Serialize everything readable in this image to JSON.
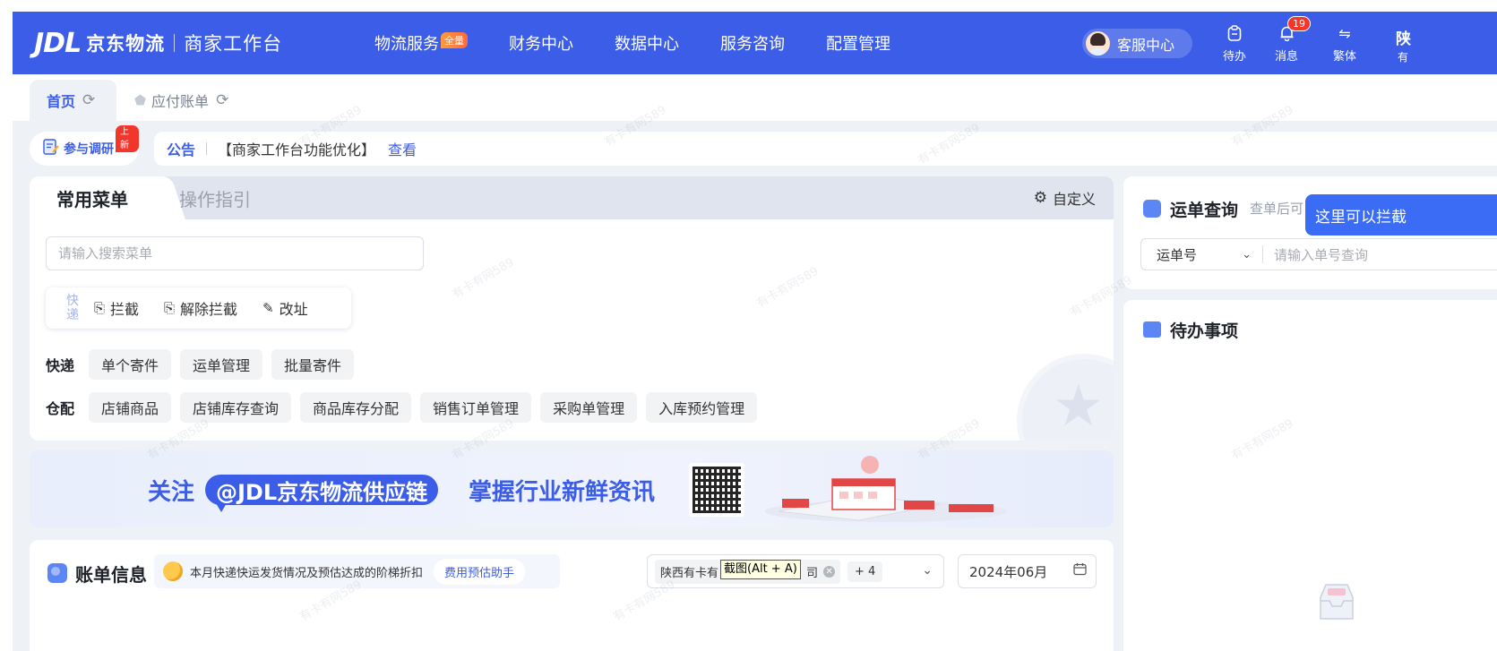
{
  "brand": {
    "logo": "JDL",
    "name": "京东物流",
    "product": "商家工作台"
  },
  "nav": {
    "items": [
      {
        "label": "物流服务",
        "badge": "全量"
      },
      {
        "label": "财务中心"
      },
      {
        "label": "数据中心"
      },
      {
        "label": "服务咨询"
      },
      {
        "label": "配置管理"
      }
    ],
    "customer_service": "客服中心",
    "tools": {
      "todo": "待办",
      "messages": "消息",
      "message_count": "19",
      "traditional": "繁体"
    },
    "user_short": "陕",
    "user_short_2": "有"
  },
  "tabs": {
    "home": "首页",
    "payable": "应付账单"
  },
  "survey": {
    "label": "参与调研",
    "badge": "上新"
  },
  "notice": {
    "label": "公告",
    "text": "【商家工作台功能优化】",
    "link": "查看"
  },
  "menu": {
    "tab_common": "常用菜单",
    "tab_guide": "操作指引",
    "customize": "自定义",
    "search_placeholder": "请输入搜索菜单",
    "quick_tag": "快递",
    "quick_items": [
      "拦截",
      "解除拦截",
      "改址"
    ],
    "rows": [
      {
        "label": "快递",
        "chips": [
          "单个寄件",
          "运单管理",
          "批量寄件"
        ]
      },
      {
        "label": "仓配",
        "chips": [
          "店铺商品",
          "店铺库存查询",
          "商品库存分配",
          "销售订单管理",
          "采购单管理",
          "入库预约管理"
        ]
      }
    ]
  },
  "banner": {
    "follow": "关注",
    "account": "@JDL京东物流供应链",
    "slogan": "掌握行业新鲜资讯"
  },
  "bill": {
    "title": "账单信息",
    "tip": "本月快递快运发货情况及预估达成的阶梯折扣",
    "tip_button": "费用预估助手",
    "company_tag": "陕西有卡有",
    "company_tag_tail": "司",
    "more_count": "+ 4",
    "month": "2024年06月",
    "tooltip": "截图(Alt + A)"
  },
  "waybill": {
    "title": "运单查询",
    "hint": "查单后可",
    "tooltip": "这里可以拦截",
    "type": "运单号",
    "placeholder": "请输入单号查询"
  },
  "todo": {
    "title": "待办事项"
  },
  "watermark": "有卡有网589"
}
